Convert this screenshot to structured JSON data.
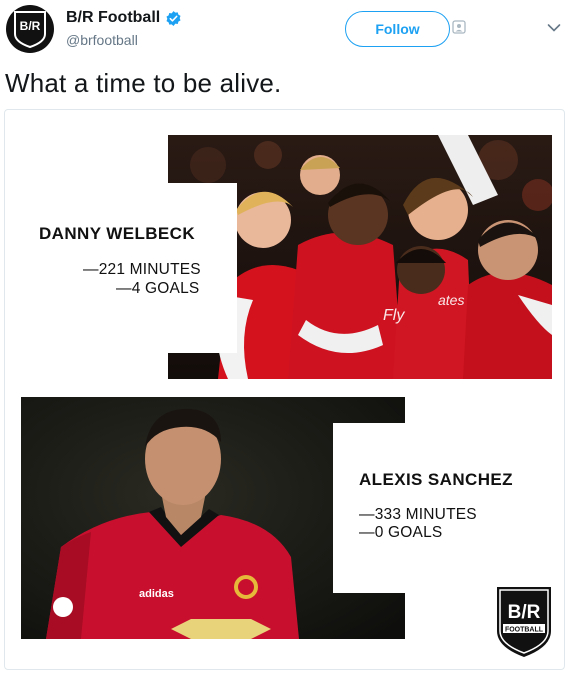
{
  "account": {
    "display_name": "B/R Football",
    "handle": "@brfootball",
    "avatar_text": "B/R",
    "verified_icon": "verified-badge-icon"
  },
  "actions": {
    "follow_label": "Follow"
  },
  "tweet": {
    "text": "What a time to be alive."
  },
  "card": {
    "player1": {
      "name": "DANNY WELBECK",
      "minutes": "—221 MINUTES",
      "goals": "—4 GOALS"
    },
    "player2": {
      "name": "ALEXIS SANCHEZ",
      "minutes": "—333 MINUTES",
      "goals": "—0 GOALS"
    },
    "logo": {
      "top_text": "B/R",
      "bottom_text": "FOOTBALL"
    }
  },
  "colors": {
    "twitter_blue": "#1da1f2",
    "arsenal_red": "#d4121e",
    "man_utd_red": "#c8102e"
  }
}
